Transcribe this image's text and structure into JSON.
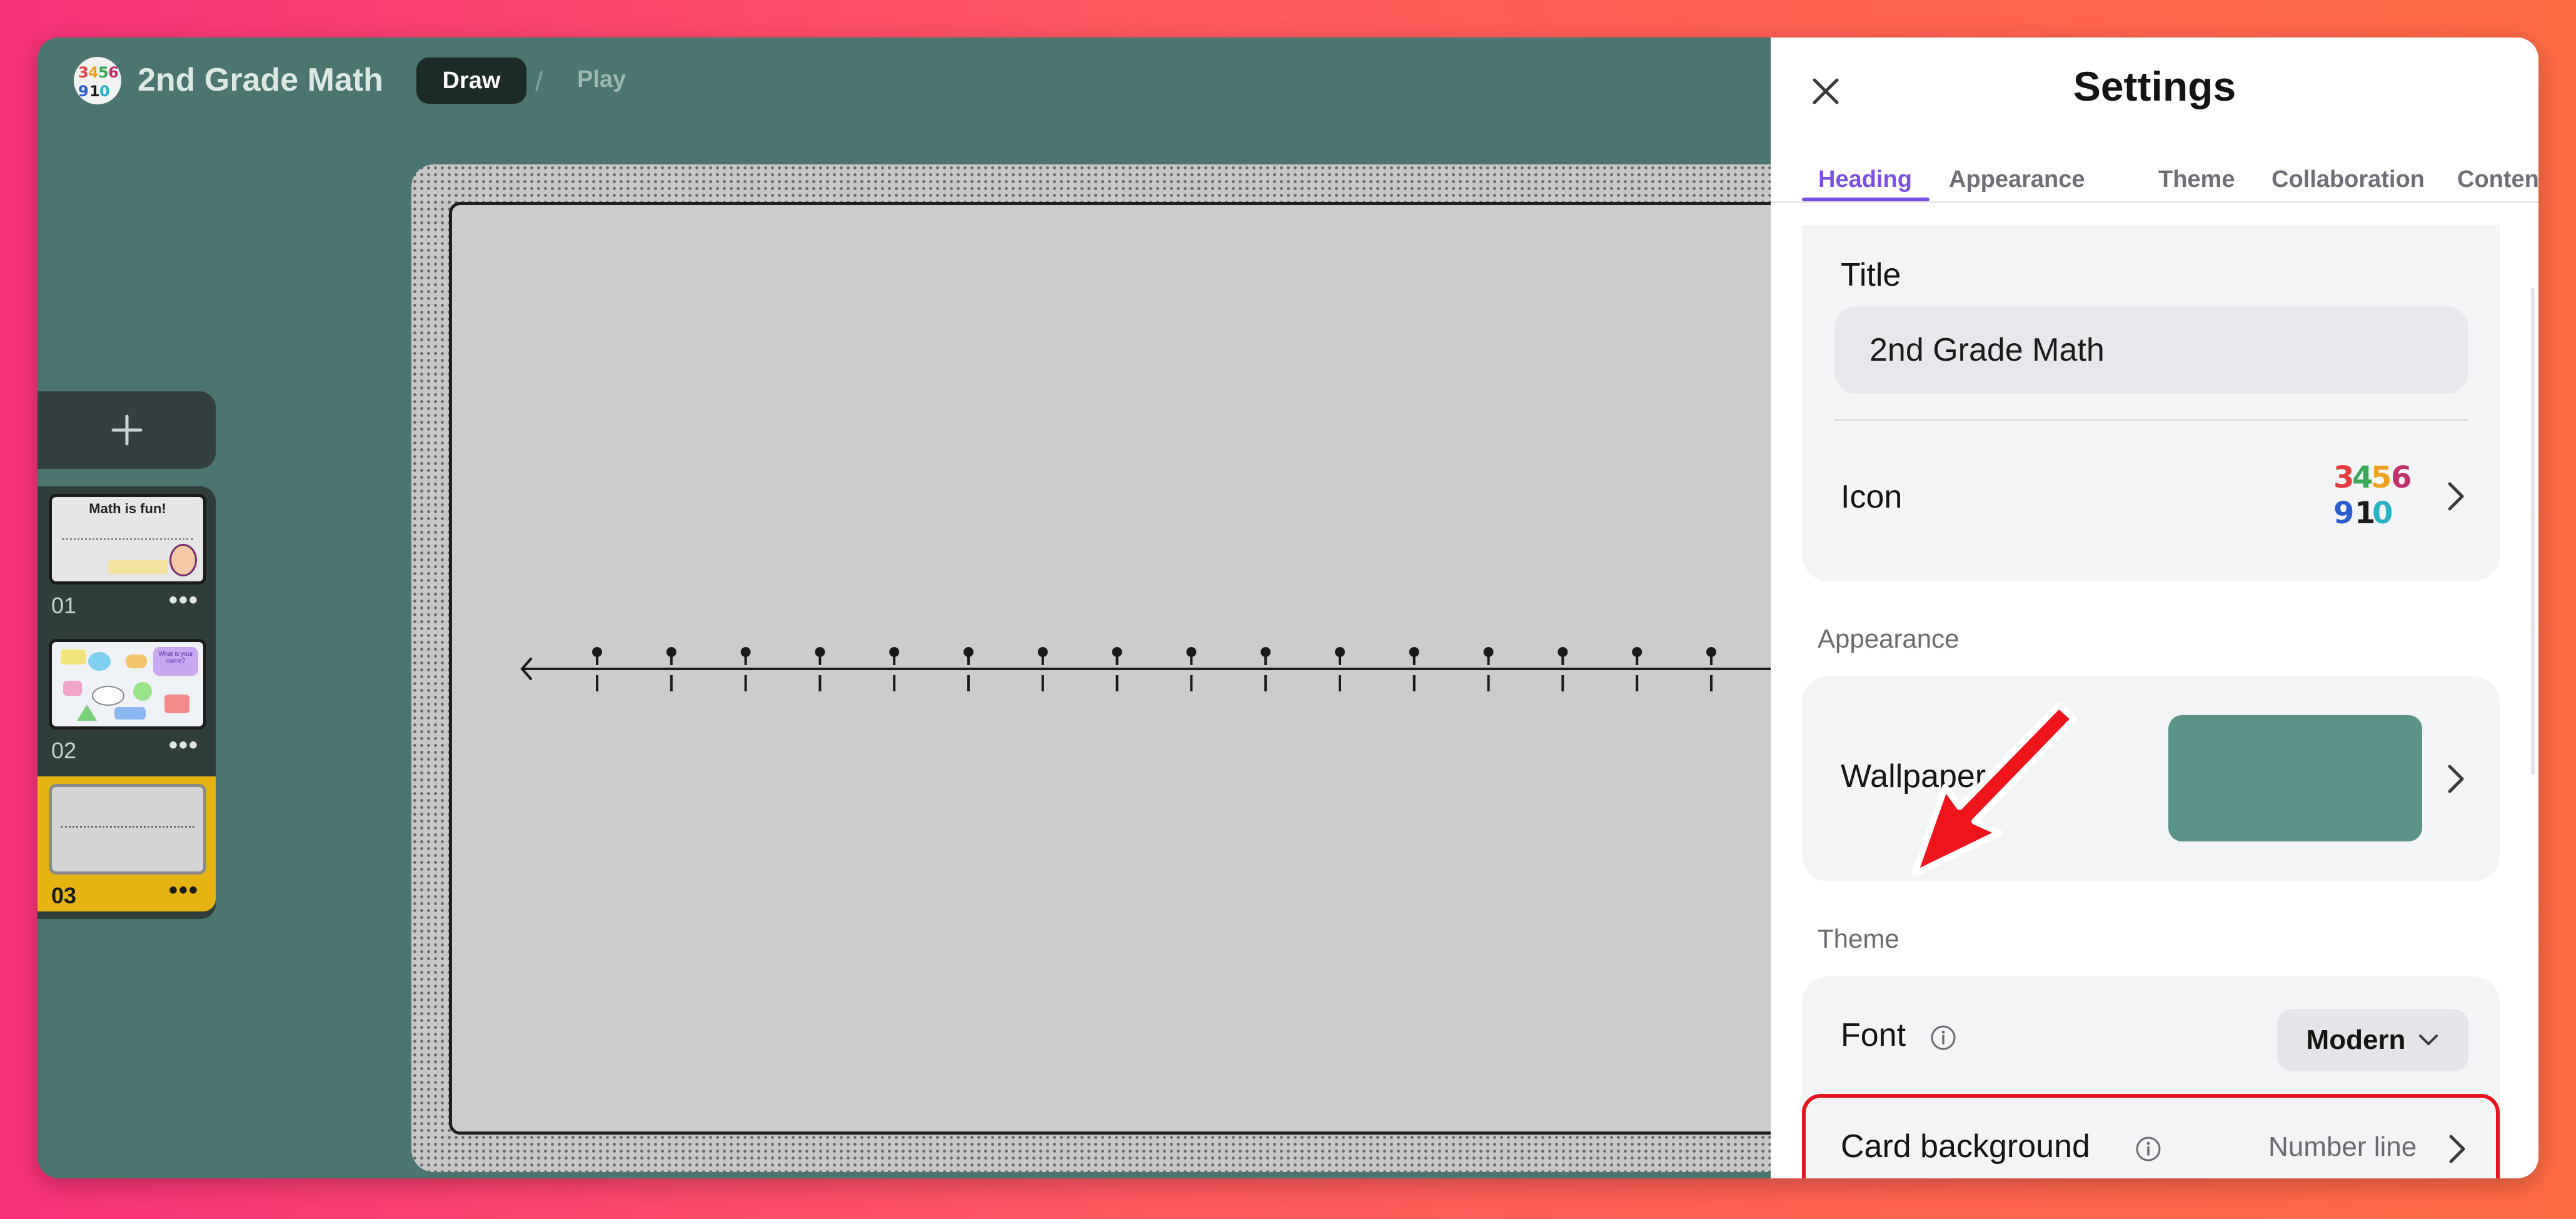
{
  "app": {
    "title": "2nd Grade Math",
    "icon": "number-blocks-icon",
    "modes": {
      "draw": "Draw",
      "separator": "/",
      "play": "Play"
    }
  },
  "slides": {
    "add_icon": "plus-icon",
    "items": [
      {
        "number": "01",
        "more_icon": "more-dots-icon",
        "thumb_text": "Math is fun!",
        "active": false
      },
      {
        "number": "02",
        "more_icon": "more-dots-icon",
        "thumb_text": "What is your name?",
        "active": false
      },
      {
        "number": "03",
        "more_icon": "more-dots-icon",
        "thumb_text": "",
        "active": true
      }
    ]
  },
  "canvas": {
    "background": "number-line",
    "tick_count": 17
  },
  "settings": {
    "title": "Settings",
    "close_icon": "close-icon",
    "tabs": [
      "Heading",
      "Appearance",
      "Theme",
      "Collaboration",
      "Content"
    ],
    "active_tab": "Heading",
    "heading": {
      "title_label": "Title",
      "title_value": "2nd Grade Math",
      "icon_label": "Icon"
    },
    "appearance": {
      "section_label": "Appearance",
      "wallpaper_label": "Wallpaper",
      "wallpaper_color": "#5a9488"
    },
    "theme": {
      "section_label": "Theme",
      "font_label": "Font",
      "font_value": "Modern",
      "card_background_label": "Card background",
      "card_background_value": "Number line"
    }
  },
  "colors": {
    "accent": "#7b4ee6",
    "highlight": "#e8141e",
    "active_slide": "#e5b412",
    "app_background": "#4b766f"
  }
}
